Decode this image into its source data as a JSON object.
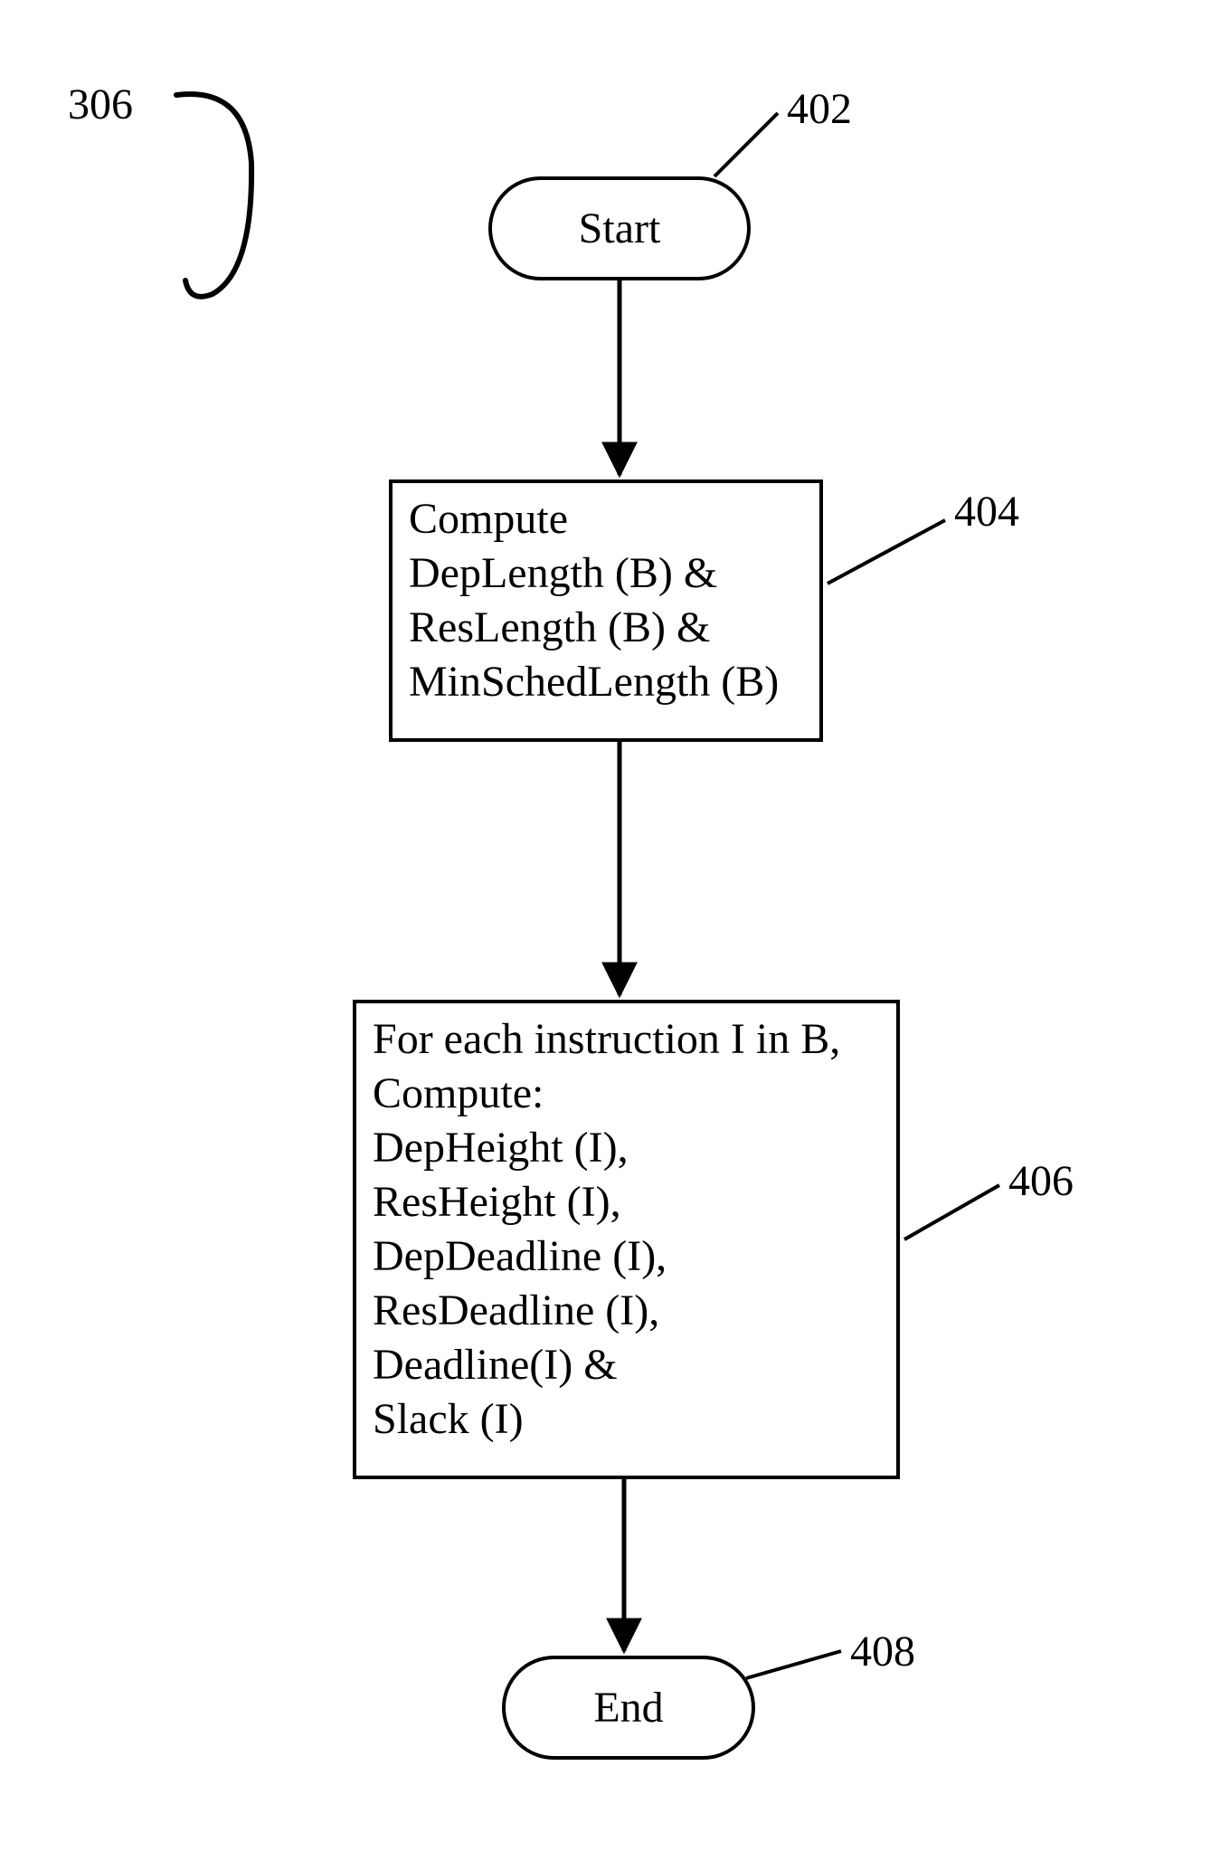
{
  "figure": {
    "ref_label_306": "306",
    "labels": {
      "start": "402",
      "step_compute_block": "404",
      "step_compute_instr": "406",
      "end": "408"
    },
    "terminators": {
      "start": "Start",
      "end": "End"
    },
    "steps": {
      "compute_block": {
        "l1": "Compute",
        "l2": "DepLength (B) &",
        "l3": "ResLength (B) &",
        "l4": "MinSchedLength (B)"
      },
      "compute_instr": {
        "l1": "For each instruction I in B,",
        "l2": "Compute:",
        "l3": "DepHeight (I),",
        "l4": "ResHeight (I),",
        "l5": "DepDeadline (I),",
        "l6": "ResDeadline (I),",
        "l7": "Deadline(I) &",
        "l8": "Slack (I)"
      }
    }
  }
}
